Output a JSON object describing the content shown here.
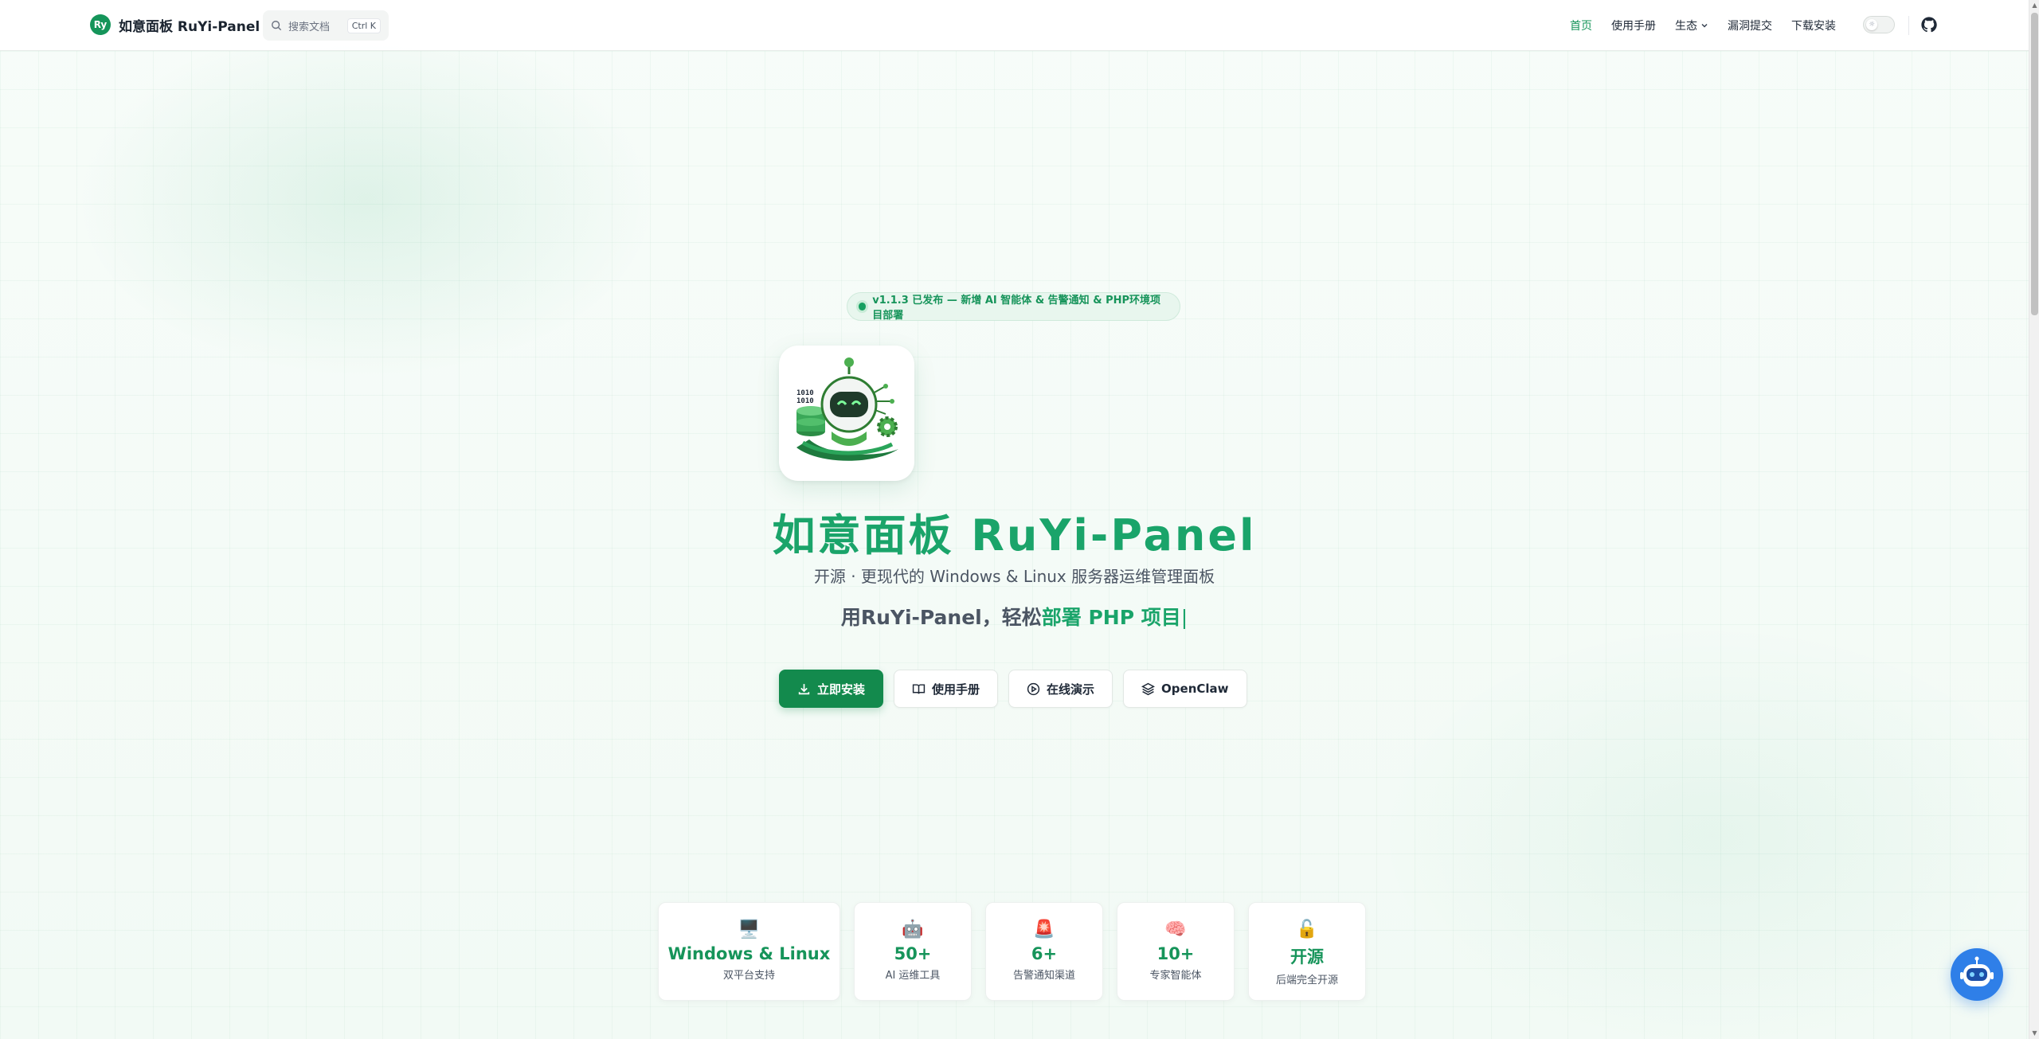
{
  "nav": {
    "brand_logo_text": "Ry",
    "brand_name": "如意面板 RuYi-Panel",
    "search_placeholder": "搜索文档",
    "search_shortcut": "Ctrl K",
    "links": [
      {
        "label": "首页",
        "active": true
      },
      {
        "label": "使用手册",
        "active": false
      },
      {
        "label": "生态",
        "active": false,
        "dropdown": true
      },
      {
        "label": "漏洞提交",
        "active": false
      },
      {
        "label": "下载安装",
        "active": false
      }
    ],
    "theme_toggle_icon": "sun-icon",
    "github_icon": "github-icon"
  },
  "hero": {
    "badge": "v1.1.3 已发布 — 新增 AI 智能体 & 告警通知 & PHP环境项目部署",
    "title": "如意面板 RuYi-Panel",
    "subtitle": "开源 · 更现代的 Windows & Linux 服务器运维管理面板",
    "tagline_prefix": "用RuYi-Panel，轻松",
    "tagline_highlight": "部署 PHP 项目",
    "tagline_caret": "|",
    "logo_text": "1010\n1010"
  },
  "buttons": [
    {
      "label": "立即安装",
      "icon": "download-icon",
      "primary": true
    },
    {
      "label": "使用手册",
      "icon": "book-icon",
      "primary": false
    },
    {
      "label": "在线演示",
      "icon": "play-circle-icon",
      "primary": false
    },
    {
      "label": "OpenClaw",
      "icon": "layers-icon",
      "primary": false
    }
  ],
  "stats": [
    {
      "icon": "🖥️",
      "value": "Windows & Linux",
      "label": "双平台支持"
    },
    {
      "icon": "🤖",
      "value": "50+",
      "label": "AI 运维工具"
    },
    {
      "icon": "🚨",
      "value": "6+",
      "label": "告警通知渠道"
    },
    {
      "icon": "🧠",
      "value": "10+",
      "label": "专家智能体"
    },
    {
      "icon": "🔓",
      "value": "开源",
      "label": "后端完全开源"
    }
  ],
  "colors": {
    "brand_green": "#16945a",
    "primary_button": "#138a4d",
    "assistant_blue": "#2f7fe8"
  }
}
